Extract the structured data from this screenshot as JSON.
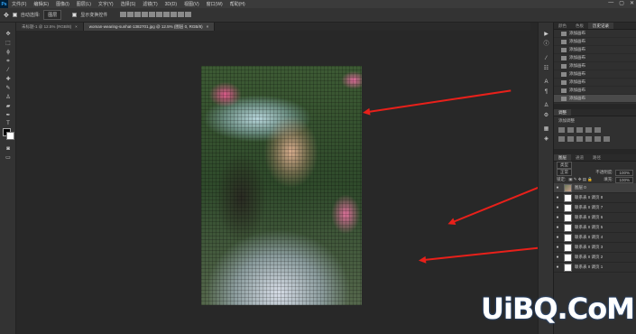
{
  "app": {
    "logo": "Ps"
  },
  "menu": [
    "文件(F)",
    "编辑(E)",
    "图像(I)",
    "图层(L)",
    "文字(Y)",
    "选择(S)",
    "滤镜(T)",
    "3D(D)",
    "视图(V)",
    "窗口(W)",
    "帮助(H)"
  ],
  "window_controls": [
    "—",
    "▢",
    "✕"
  ],
  "options_bar": {
    "auto_select_label": "自动选择:",
    "auto_select_value": "图层",
    "transform_label": "显示变换控件"
  },
  "tabs": [
    {
      "label": "未标题-1 @ 12.5% (RGB/8)",
      "close": "×",
      "active": false
    },
    {
      "label": "woman-wearing-sunhat-1382701.jpg @ 12.5% (图层 0, RGB/8)",
      "close": "×",
      "active": true
    }
  ],
  "panels": {
    "history_tabs": [
      "颜色",
      "色板",
      "历史记录"
    ],
    "history_items": [
      "添加画布",
      "添加画布",
      "添加画布",
      "添加画布",
      "添加画布",
      "添加画布",
      "添加画布",
      "添加画布",
      "添加画布"
    ],
    "adjust_tab": "调整",
    "adjust_subtitle": "添加调整",
    "layers_tabs": [
      "图层",
      "通道",
      "路径"
    ],
    "kind": "类型",
    "blend_mode": "正常",
    "opacity_label": "不透明度:",
    "opacity_value": "100%",
    "lock_label": "锁定:",
    "fill_label": "填充:",
    "fill_value": "100%",
    "layers": [
      {
        "name": "图层 0",
        "thumb": "image"
      },
      {
        "name": "联系表 II 调页 8",
        "thumb": "white"
      },
      {
        "name": "联系表 II 调页 7",
        "thumb": "white"
      },
      {
        "name": "联系表 II 调页 6",
        "thumb": "white"
      },
      {
        "name": "联系表 II 调页 5",
        "thumb": "white"
      },
      {
        "name": "联系表 II 调页 4",
        "thumb": "white"
      },
      {
        "name": "联系表 II 调页 3",
        "thumb": "white"
      },
      {
        "name": "联系表 II 调页 2",
        "thumb": "white"
      },
      {
        "name": "联系表 II 调页 1",
        "thumb": "white"
      }
    ]
  },
  "watermark": "UiBQ.CoM",
  "colors": {
    "arrow": "#e8201a",
    "canvas_bg": "#282828",
    "panel_bg": "#2f2f2f"
  }
}
